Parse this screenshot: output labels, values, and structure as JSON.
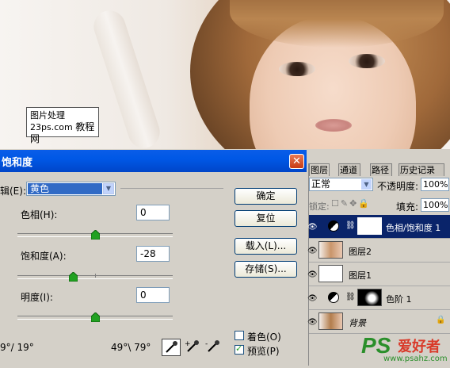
{
  "photo": {
    "watermark_line1": "图片处理",
    "watermark_line2": "23ps.com",
    "watermark_line3": "教程网"
  },
  "dialog": {
    "title": "饱和度",
    "edit_label": "辑(E):",
    "edit_value": "黄色",
    "hue_label": "色相(H):",
    "hue_value": "0",
    "saturation_label": "饱和度(A):",
    "saturation_value": "-28",
    "lightness_label": "明度(I):",
    "lightness_value": "0",
    "hue_level": 0.5,
    "saturation_level": 0.36,
    "lightness_level": 0.5,
    "range_left": "9°/ 19°",
    "range_right": "49°\\ 79°",
    "buttons": {
      "ok": "确定",
      "reset": "复位",
      "load": "载入(L)...",
      "save": "存储(S)..."
    },
    "colorize_label": "着色(O)",
    "colorize_checked": false,
    "preview_label": "预览(P)",
    "preview_checked": true
  },
  "layers_panel": {
    "tabs": [
      "图层",
      "通道",
      "路径",
      "历史记录"
    ],
    "blend_mode": "正常",
    "opacity_label": "不透明度:",
    "opacity_value": "100%",
    "lock_label": "锁定:",
    "fill_label": "填充:",
    "fill_value": "100%",
    "layers": [
      {
        "name": "色相/饱和度 1",
        "selected": true
      },
      {
        "name": "图层2",
        "selected": false
      },
      {
        "name": "图层1",
        "selected": false
      },
      {
        "name": "色阶 1",
        "selected": false
      },
      {
        "name": "背景",
        "selected": false
      }
    ]
  },
  "logo": {
    "brand": "爱好者",
    "url": "www.psahz.com"
  },
  "colors": {
    "titlebar": "#0058e6",
    "selection": "#0a246a",
    "close": "#c83b14"
  }
}
